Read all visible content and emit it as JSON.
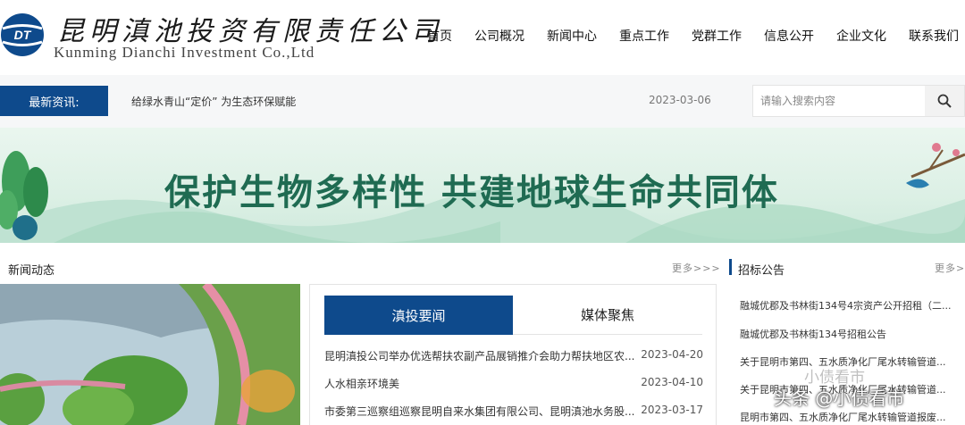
{
  "header": {
    "logo_mark": "DT",
    "company_cn": "昆明滇池投资有限责任公司",
    "company_en": "Kunming Dianchi Investment Co.,Ltd",
    "nav": [
      "首页",
      "公司概况",
      "新闻中心",
      "重点工作",
      "党群工作",
      "信息公开",
      "企业文化",
      "联系我们"
    ]
  },
  "ticker": {
    "label": "最新资讯:",
    "headline": "给绿水青山“定价” 为生态环保赋能",
    "date": "2023-03-06"
  },
  "search": {
    "placeholder": "请输入搜索内容",
    "icon": "search-icon"
  },
  "banner": {
    "title": "保护生物多样性 共建地球生命共同体"
  },
  "news_section": {
    "title": "新闻动态",
    "more": "更多>>>"
  },
  "tabs": {
    "active": "滇投要闻",
    "inactive": "媒体聚焦"
  },
  "news": [
    {
      "title": "昆明滇投公司举办优选帮扶农副产品展销推介会助力帮扶地区农...",
      "date": "2023-04-20"
    },
    {
      "title": "人水相亲环境美",
      "date": "2023-04-10"
    },
    {
      "title": "市委第三巡察组巡察昆明自来水集团有限公司、昆明滇池水务股...",
      "date": "2023-03-17"
    }
  ],
  "tender_section": {
    "title": "招标公告",
    "more": "更多>"
  },
  "tenders": [
    "融城优郡及书林街134号4宗资产公开招租（二...",
    "融城优郡及书林街134号招租公告",
    "关于昆明市第四、五水质净化厂尾水转输管道...",
    "关于昆明市第四、五水质净化厂尾水转输管道...",
    "昆明市第四、五水质净化厂尾水转输管道报废..."
  ],
  "watermark": {
    "main": "头条 @小债看市",
    "faint": "小债看市"
  },
  "colors": {
    "brand_blue": "#0e4a8c",
    "banner_green": "#1f6b52"
  }
}
